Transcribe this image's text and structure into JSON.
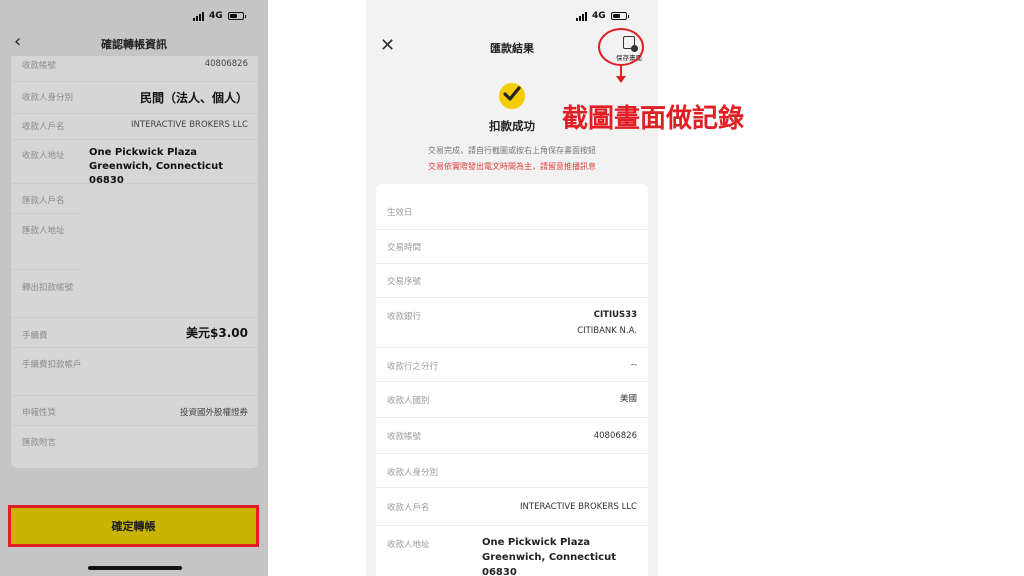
{
  "status_bar": {
    "network": "4G"
  },
  "left": {
    "title": "確認轉帳資訊",
    "rows": [
      {
        "label": "收款帳號",
        "value": "40806826"
      },
      {
        "label": "收款人身分別",
        "value": "民間（法人、個人）"
      },
      {
        "label": "收款人戶名",
        "value": "INTERACTIVE BROKERS LLC"
      },
      {
        "label": "收款人地址",
        "value": "One Pickwick Plaza Greenwich, Connecticut 06830"
      },
      {
        "label": "匯款人戶名",
        "value": ""
      },
      {
        "label": "匯款人地址",
        "value": ""
      },
      {
        "label": "轉出扣款帳號",
        "value": ""
      },
      {
        "label": "手續費",
        "value": "美元$3.00"
      },
      {
        "label": "手續費扣款帳戶",
        "value": ""
      },
      {
        "label": "申報性質",
        "value": "投資國外股權證券"
      },
      {
        "label": "匯款附言",
        "value": ""
      }
    ],
    "confirm_label": "確定轉帳"
  },
  "right": {
    "title": "匯款結果",
    "save_label": "保存畫面",
    "success_text": "扣款成功",
    "note1": "交易完成，請自行截圖或按右上角保存畫面按鈕",
    "note2": "交易依實際發出電文時間為主，請留意推播訊息",
    "rows": [
      {
        "label": "生效日",
        "value": ""
      },
      {
        "label": "交易時間",
        "value": ""
      },
      {
        "label": "交易序號",
        "value": ""
      },
      {
        "label": "收款銀行",
        "value": "CITIUS33",
        "value2": "CITIBANK N.A."
      },
      {
        "label": "收款行之分行",
        "value": "--"
      },
      {
        "label": "收款人國別",
        "value": "美國"
      },
      {
        "label": "收款帳號",
        "value": "40806826"
      },
      {
        "label": "收款人身分別",
        "value": ""
      },
      {
        "label": "收款人戶名",
        "value": "INTERACTIVE BROKERS LLC"
      },
      {
        "label": "收款人地址",
        "value": "One Pickwick Plaza Greenwich, Connecticut 06830"
      }
    ]
  },
  "annotation": "截圖畫面做記錄",
  "colors": {
    "accent_yellow": "#c9b400",
    "highlight_red": "#e01e24",
    "check_yellow": "#f5cc00"
  }
}
